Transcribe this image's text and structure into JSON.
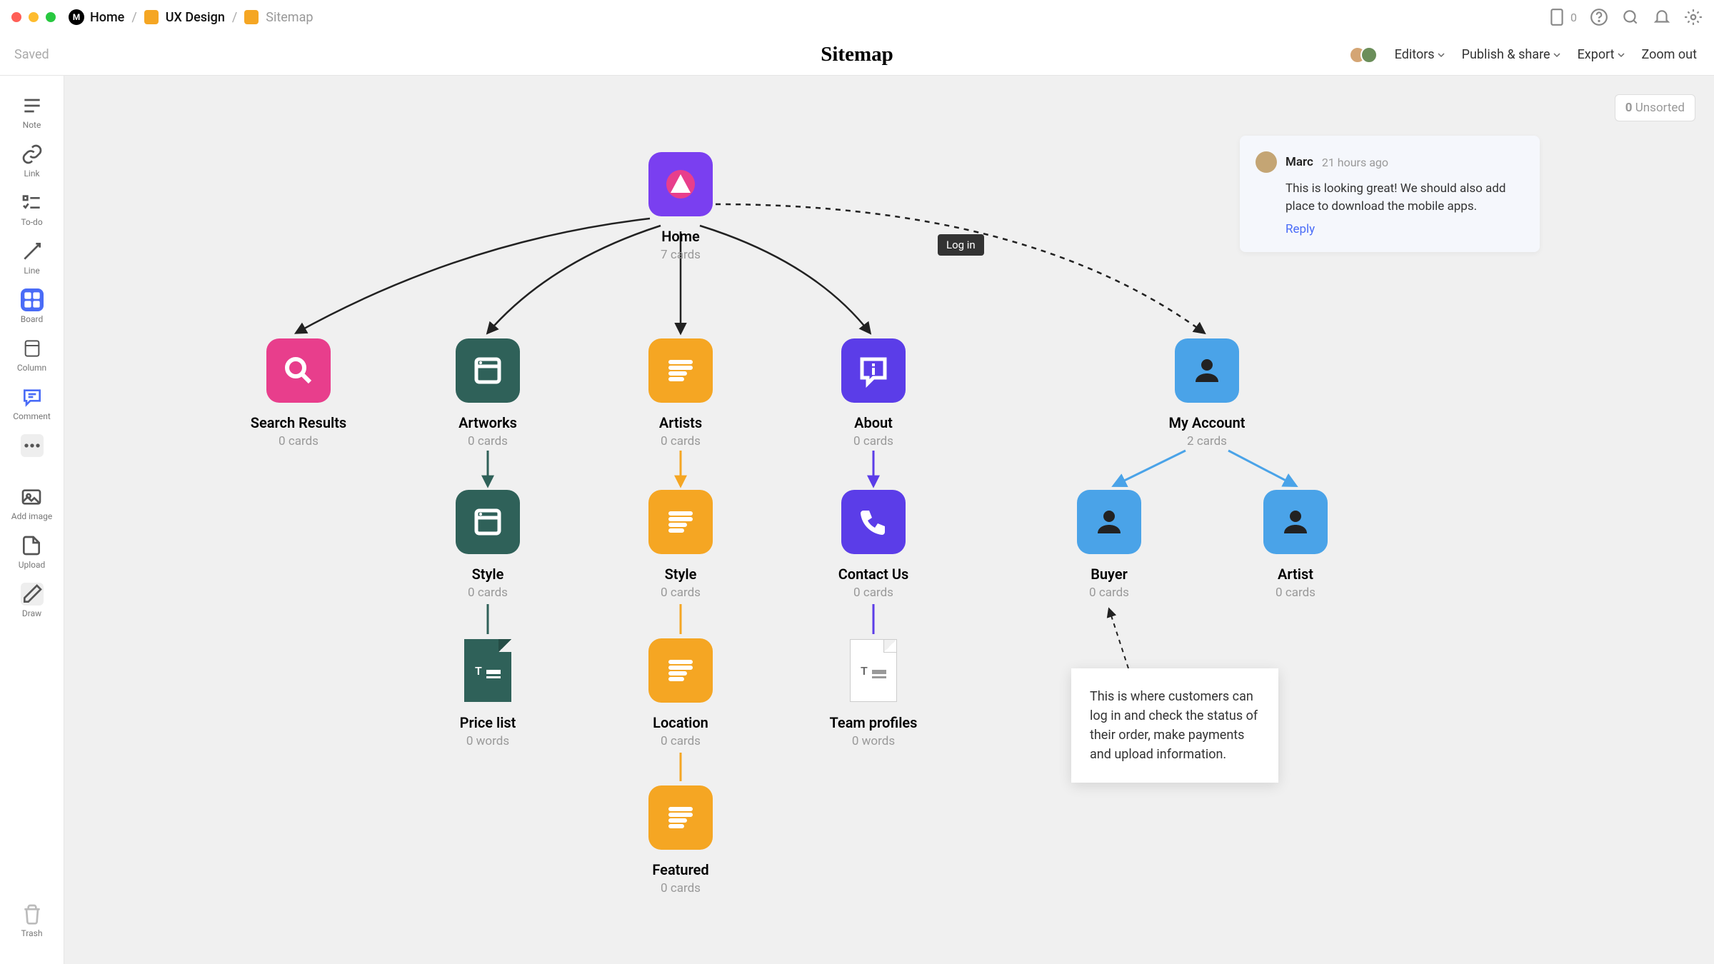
{
  "window": {
    "brand": "M",
    "crumbs": [
      "Home",
      "UX Design",
      "Sitemap"
    ],
    "mini_count": "0"
  },
  "subbar": {
    "saved": "Saved",
    "title": "Sitemap",
    "editors": "Editors",
    "publish": "Publish & share",
    "export": "Export",
    "zoom": "Zoom out"
  },
  "toolbar": {
    "items": [
      "Note",
      "Link",
      "To-do",
      "Line",
      "Board",
      "Column",
      "Comment",
      "",
      "Add image",
      "Upload",
      "Draw",
      "Trash"
    ]
  },
  "unsorted": {
    "count": "0",
    "label": "Unsorted"
  },
  "nodes": {
    "home": {
      "title": "Home",
      "sub": "7 cards",
      "color": "#7a3ff0"
    },
    "search": {
      "title": "Search Results",
      "sub": "0 cards",
      "color": "#e83e8c"
    },
    "artworks": {
      "title": "Artworks",
      "sub": "0 cards",
      "color": "#2f6159"
    },
    "artists": {
      "title": "Artists",
      "sub": "0 cards",
      "color": "#f5a623"
    },
    "about": {
      "title": "About",
      "sub": "0 cards",
      "color": "#5b3de8"
    },
    "myaccount": {
      "title": "My Account",
      "sub": "2 cards",
      "color": "#4aa3e8"
    },
    "style1": {
      "title": "Style",
      "sub": "0 cards",
      "color": "#2f6159"
    },
    "style2": {
      "title": "Style",
      "sub": "0 cards",
      "color": "#f5a623"
    },
    "contact": {
      "title": "Contact Us",
      "sub": "0 cards",
      "color": "#5b3de8"
    },
    "buyer": {
      "title": "Buyer",
      "sub": "0 cards",
      "color": "#4aa3e8"
    },
    "artist": {
      "title": "Artist",
      "sub": "0 cards",
      "color": "#4aa3e8"
    },
    "pricelist": {
      "title": "Price list",
      "sub": "0 words"
    },
    "location": {
      "title": "Location",
      "sub": "0 cards",
      "color": "#f5a623"
    },
    "teamprofiles": {
      "title": "Team profiles",
      "sub": "0 words"
    },
    "featured": {
      "title": "Featured",
      "sub": "0 cards",
      "color": "#f5a623"
    }
  },
  "login_label": "Log in",
  "comment": {
    "author": "Marc",
    "time": "21 hours ago",
    "body": "This is looking great! We should also add place to download the mobile apps.",
    "reply": "Reply"
  },
  "note": {
    "text": "This is where customers can log in and check the status of their order, make payments and upload information."
  }
}
